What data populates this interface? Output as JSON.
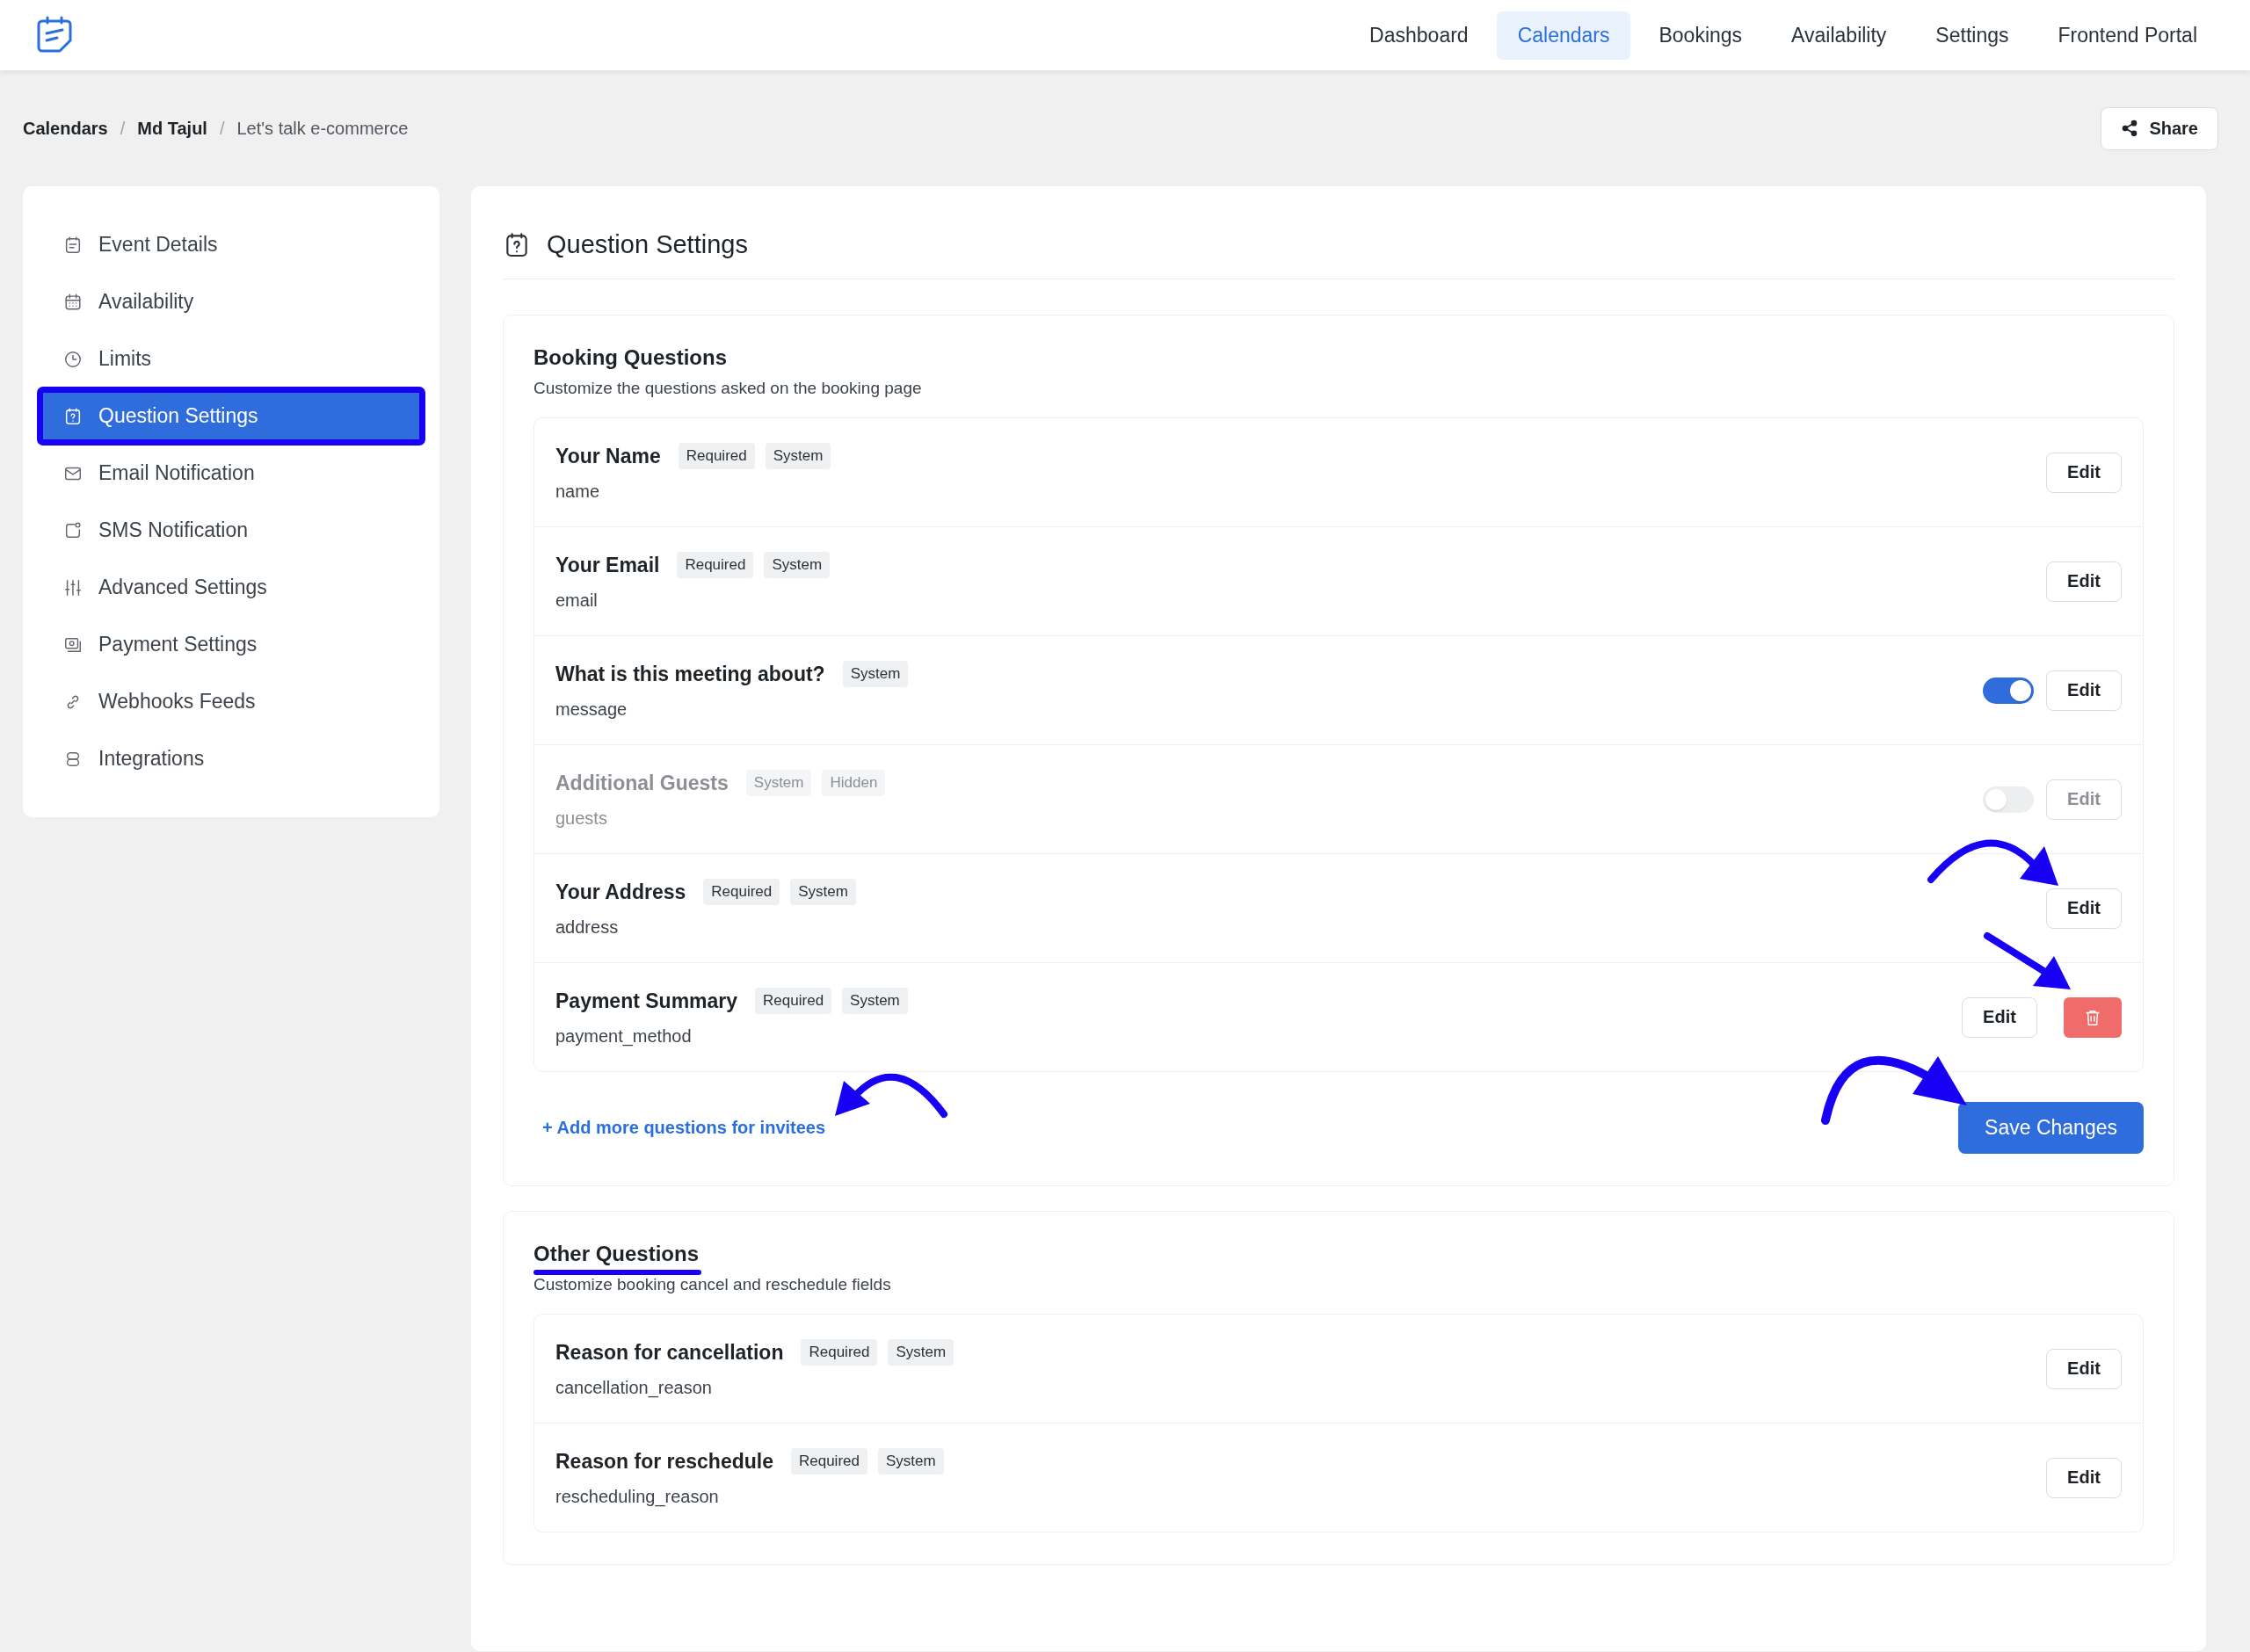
{
  "nav": {
    "items": [
      {
        "label": "Dashboard",
        "selected": false
      },
      {
        "label": "Calendars",
        "selected": true
      },
      {
        "label": "Bookings",
        "selected": false
      },
      {
        "label": "Availability",
        "selected": false
      },
      {
        "label": "Settings",
        "selected": false
      },
      {
        "label": "Frontend Portal",
        "selected": false
      }
    ]
  },
  "breadcrumb": [
    {
      "label": "Calendars",
      "kind": "link"
    },
    {
      "label": "/",
      "kind": "separator"
    },
    {
      "label": "Md Tajul",
      "kind": "link"
    },
    {
      "label": "/",
      "kind": "separator"
    },
    {
      "label": "Let's talk e-commerce",
      "kind": "current"
    }
  ],
  "share_button": "Share",
  "sidebar": {
    "items": [
      {
        "label": "Event Details",
        "selected": false
      },
      {
        "label": "Availability",
        "selected": false
      },
      {
        "label": "Limits",
        "selected": false
      },
      {
        "label": "Question Settings",
        "selected": true
      },
      {
        "label": "Email Notification",
        "selected": false
      },
      {
        "label": "SMS Notification",
        "selected": false
      },
      {
        "label": "Advanced Settings",
        "selected": false
      },
      {
        "label": "Payment Settings",
        "selected": false
      },
      {
        "label": "Webhooks Feeds",
        "selected": false
      },
      {
        "label": "Integrations",
        "selected": false
      }
    ]
  },
  "page_title": "Question Settings",
  "sections": [
    {
      "title": "Booking Questions",
      "description": "Customize the questions asked on the booking page",
      "questions": [
        {
          "title": "Your Name",
          "tags": [
            "Required",
            "System"
          ],
          "field": "name",
          "kind": "plain",
          "disabled": false,
          "edit": "Edit"
        },
        {
          "title": "Your Email",
          "tags": [
            "Required",
            "System"
          ],
          "field": "email",
          "kind": "plain",
          "disabled": false,
          "edit": "Edit"
        },
        {
          "title": "What is this meeting about?",
          "tags": [
            "System"
          ],
          "field": "message",
          "kind": "toggle",
          "on": true,
          "disabled": false,
          "edit": "Edit"
        },
        {
          "title": "Additional Guests",
          "tags": [
            "System",
            "Hidden"
          ],
          "field": "guests",
          "kind": "toggle",
          "on": false,
          "disabled": true,
          "edit": "Edit"
        },
        {
          "title": "Your Address",
          "tags": [
            "Required",
            "System"
          ],
          "field": "address",
          "kind": "plain",
          "disabled": false,
          "edit": "Edit"
        },
        {
          "title": "Payment Summary",
          "tags": [
            "Required",
            "System"
          ],
          "field": "payment_method",
          "kind": "deletable",
          "disabled": false,
          "edit": "Edit"
        }
      ],
      "add_link": "+ Add more questions for invitees",
      "save_button": "Save Changes"
    },
    {
      "title": "Other Questions",
      "description": "Customize booking cancel and reschedule fields",
      "questions": [
        {
          "title": "Reason for cancellation",
          "tags": [
            "Required",
            "System"
          ],
          "field": "cancellation_reason",
          "kind": "plain",
          "disabled": false,
          "edit": "Edit"
        },
        {
          "title": "Reason for reschedule",
          "tags": [
            "Required",
            "System"
          ],
          "field": "rescheduling_reason",
          "kind": "plain",
          "disabled": false,
          "edit": "Edit"
        }
      ]
    }
  ]
}
